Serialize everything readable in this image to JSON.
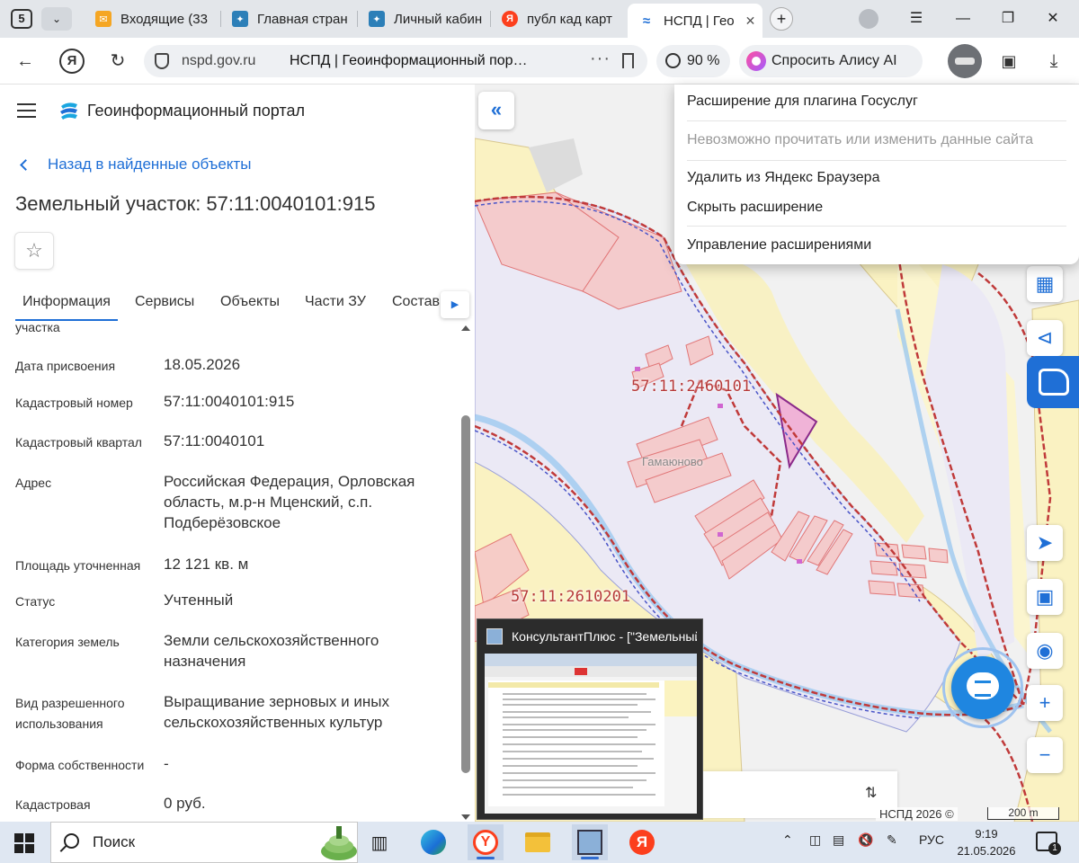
{
  "browser": {
    "tab_count": "5",
    "tabs": [
      {
        "label": "Входящие (33"
      },
      {
        "label": "Главная стран"
      },
      {
        "label": "Личный кабин"
      },
      {
        "label": "публ кад карт"
      },
      {
        "label": "НСПД | Гео"
      }
    ],
    "address": {
      "domain": "nspd.gov.ru",
      "page_title": "НСПД | Геоинформационный пор…",
      "more": "···"
    },
    "zoom": "90 %",
    "alice_label": "Спросить Алису AI"
  },
  "extension_menu": {
    "items": [
      "Расширение для плагина Госуслуг",
      "Невозможно прочитать или изменить данные сайта",
      "Удалить из Яндекс Браузера",
      "Скрыть расширение",
      "Управление расширениями"
    ]
  },
  "portal": {
    "name": "Геоинформационный портал",
    "back_link": "Назад в найденные объекты",
    "object_title": "Земельный участок: 57:11:0040101:915",
    "tabs": [
      "Информация",
      "Сервисы",
      "Объекты",
      "Части ЗУ",
      "Состав"
    ],
    "properties": [
      {
        "label": "участка",
        "value": ""
      },
      {
        "label": "Дата присвоения",
        "value": "18.05.2026"
      },
      {
        "label": "Кадастровый номер",
        "value": "57:11:0040101:915"
      },
      {
        "label": "Кадастровый квартал",
        "value": "57:11:0040101"
      },
      {
        "label": "Адрес",
        "value": "Российская Федерация, Орловская область, м.р-н Мценский, с.п. Подберёзовское"
      },
      {
        "label": "Площадь уточненная",
        "value": "12 121 кв. м"
      },
      {
        "label": "Статус",
        "value": "Учтенный"
      },
      {
        "label": "Категория земель",
        "value": "Земли сельскохозяйственного назначения"
      },
      {
        "label": "Вид разрешенного использования",
        "value": "Выращивание зерновых и иных сельскохозяйственных культур"
      },
      {
        "label": "Форма собственности",
        "value": "-"
      },
      {
        "label": "Кадастровая",
        "value": "0 руб."
      }
    ]
  },
  "map": {
    "labels": {
      "quarter_1": "57:11:2460101",
      "quarter_2": "57:11:2610201",
      "village": "Гамаюново"
    },
    "copyright": "НСПД 2026 ©",
    "scale": "200 m",
    "tools": {
      "zoom_in": "+",
      "zoom_out": "−"
    }
  },
  "thumbnail": {
    "title": "КонсультантПлюс - [\"Земельный кодекс Российской Федерации\"]"
  },
  "taskbar": {
    "search_placeholder": "Поиск",
    "language": "РУС",
    "time": "9:19",
    "date": "21.05.2026",
    "notifications": "1"
  },
  "colors": {
    "accent": "#1f6fd6",
    "map_parcel_fill": "#f6c8c8",
    "map_parcel_stroke": "#e06a6a",
    "map_farmland": "#faf2c2",
    "map_boundary": "#c03a3a",
    "map_river": "#9ec9f0"
  }
}
